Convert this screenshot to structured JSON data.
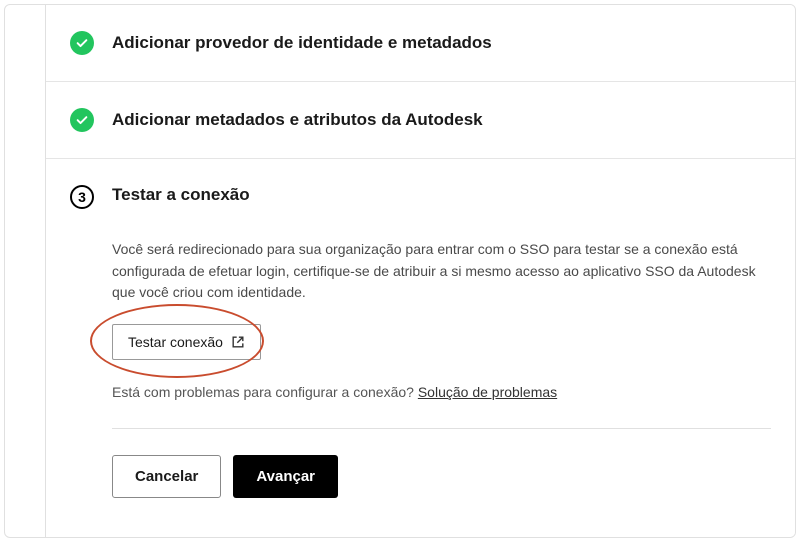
{
  "steps": {
    "step1_title": "Adicionar provedor de identidade e metadados",
    "step2_title": "Adicionar metadados e atributos da Autodesk",
    "step3_number": "3",
    "step3_title": "Testar a conexão",
    "step3_description": "Você será redirecionado para sua organização para entrar com o SSO para testar se a conexão está configurada de efetuar login, certifique-se de atribuir a si mesmo acesso ao aplicativo SSO da Autodesk que você criou com identidade.",
    "test_button_label": "Testar conexão",
    "trouble_prefix": "Está com problemas para configurar a conexão? ",
    "trouble_link": "Solução de problemas"
  },
  "footer": {
    "cancel_label": "Cancelar",
    "next_label": "Avançar"
  }
}
